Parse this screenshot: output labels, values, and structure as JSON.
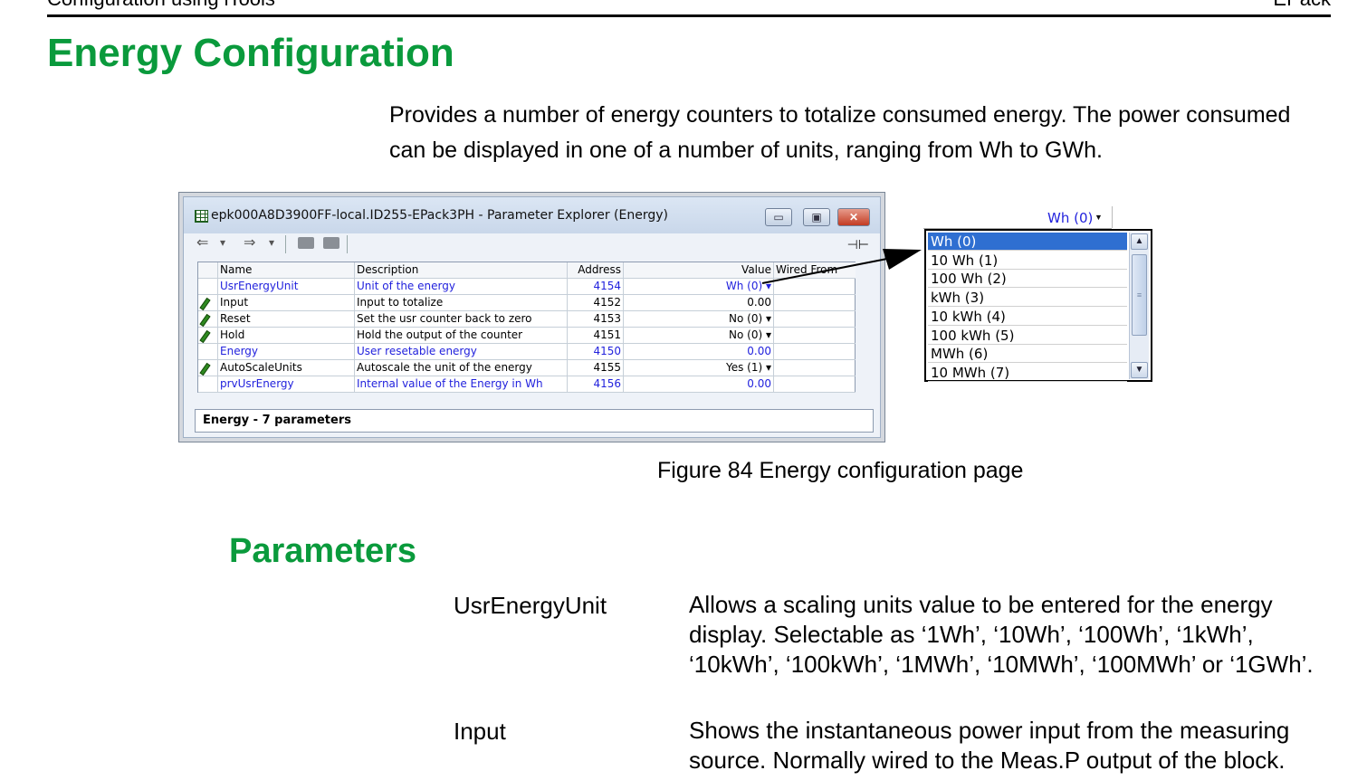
{
  "page_header": {
    "left": "Configuration using iTools",
    "right": "EPack"
  },
  "heading": "Energy Configuration",
  "intro": "Provides a number of energy counters to totalize consumed energy. The power consumed can be displayed in one of a number of units, ranging from Wh to GWh.",
  "window": {
    "title": "epk000A8D3900FF-local.ID255-EPack3PH - Parameter Explorer (Energy)",
    "buttons": {
      "minimize": "▭",
      "maximize": "▣",
      "close": "✕"
    },
    "toolbar": {
      "back": "⇐",
      "back_menu": "▾",
      "forward": "⇒",
      "forward_menu": "▾",
      "pin": "⊣⊢"
    },
    "columns": [
      "Name",
      "Description",
      "Address",
      "Value",
      "Wired From"
    ],
    "rows": [
      {
        "name": "UsrEnergyUnit",
        "description": "Unit of the energy",
        "address": "4154",
        "value": "Wh (0) ▾",
        "blue": true,
        "editable": false
      },
      {
        "name": "Input",
        "description": "Input to totalize",
        "address": "4152",
        "value": "0.00",
        "blue": false,
        "editable": true
      },
      {
        "name": "Reset",
        "description": "Set the usr counter back to zero",
        "address": "4153",
        "value": "No (0) ▾",
        "blue": false,
        "editable": true
      },
      {
        "name": "Hold",
        "description": "Hold the output of the counter",
        "address": "4151",
        "value": "No (0) ▾",
        "blue": false,
        "editable": true
      },
      {
        "name": "Energy",
        "description": "User resetable energy",
        "address": "4150",
        "value": "0.00",
        "blue": true,
        "editable": false
      },
      {
        "name": "AutoScaleUnits",
        "description": "Autoscale the unit of the energy",
        "address": "4155",
        "value": "Yes (1) ▾",
        "blue": false,
        "editable": true
      },
      {
        "name": "prvUsrEnergy",
        "description": "Internal value of the Energy in Wh",
        "address": "4156",
        "value": "0.00",
        "blue": true,
        "editable": false
      }
    ],
    "status": "Energy  -  7 parameters"
  },
  "dropdown": {
    "current": "Wh (0)",
    "options": [
      "Wh (0)",
      "10 Wh (1)",
      "100 Wh (2)",
      "kWh (3)",
      "10 kWh (4)",
      "100 kWh (5)",
      "MWh (6)",
      "10 MWh (7)"
    ],
    "selected_index": 0,
    "scroll_up": "▲",
    "scroll_down": "▼",
    "thumb_grip": "≡"
  },
  "caption": "Figure 84 Energy configuration page",
  "subheading": "Parameters",
  "parameters": [
    {
      "name": "UsrEnergyUnit",
      "description": "Allows a scaling units value to be entered for the energy display. Selectable as ‘1Wh’, ‘10Wh’, ‘100Wh’, ‘1kWh’, ‘10kWh’, ‘100kWh’, ‘1MWh’, ‘10MWh’, ‘100MWh’ or ‘1GWh’."
    },
    {
      "name": "Input",
      "description": "Shows the instantaneous power input from the measuring source. Normally wired to the Meas.P output of the block."
    }
  ],
  "colors": {
    "heading": "#0a9a3c",
    "link_blue": "#2222dd",
    "selection": "#2f6fd1"
  }
}
